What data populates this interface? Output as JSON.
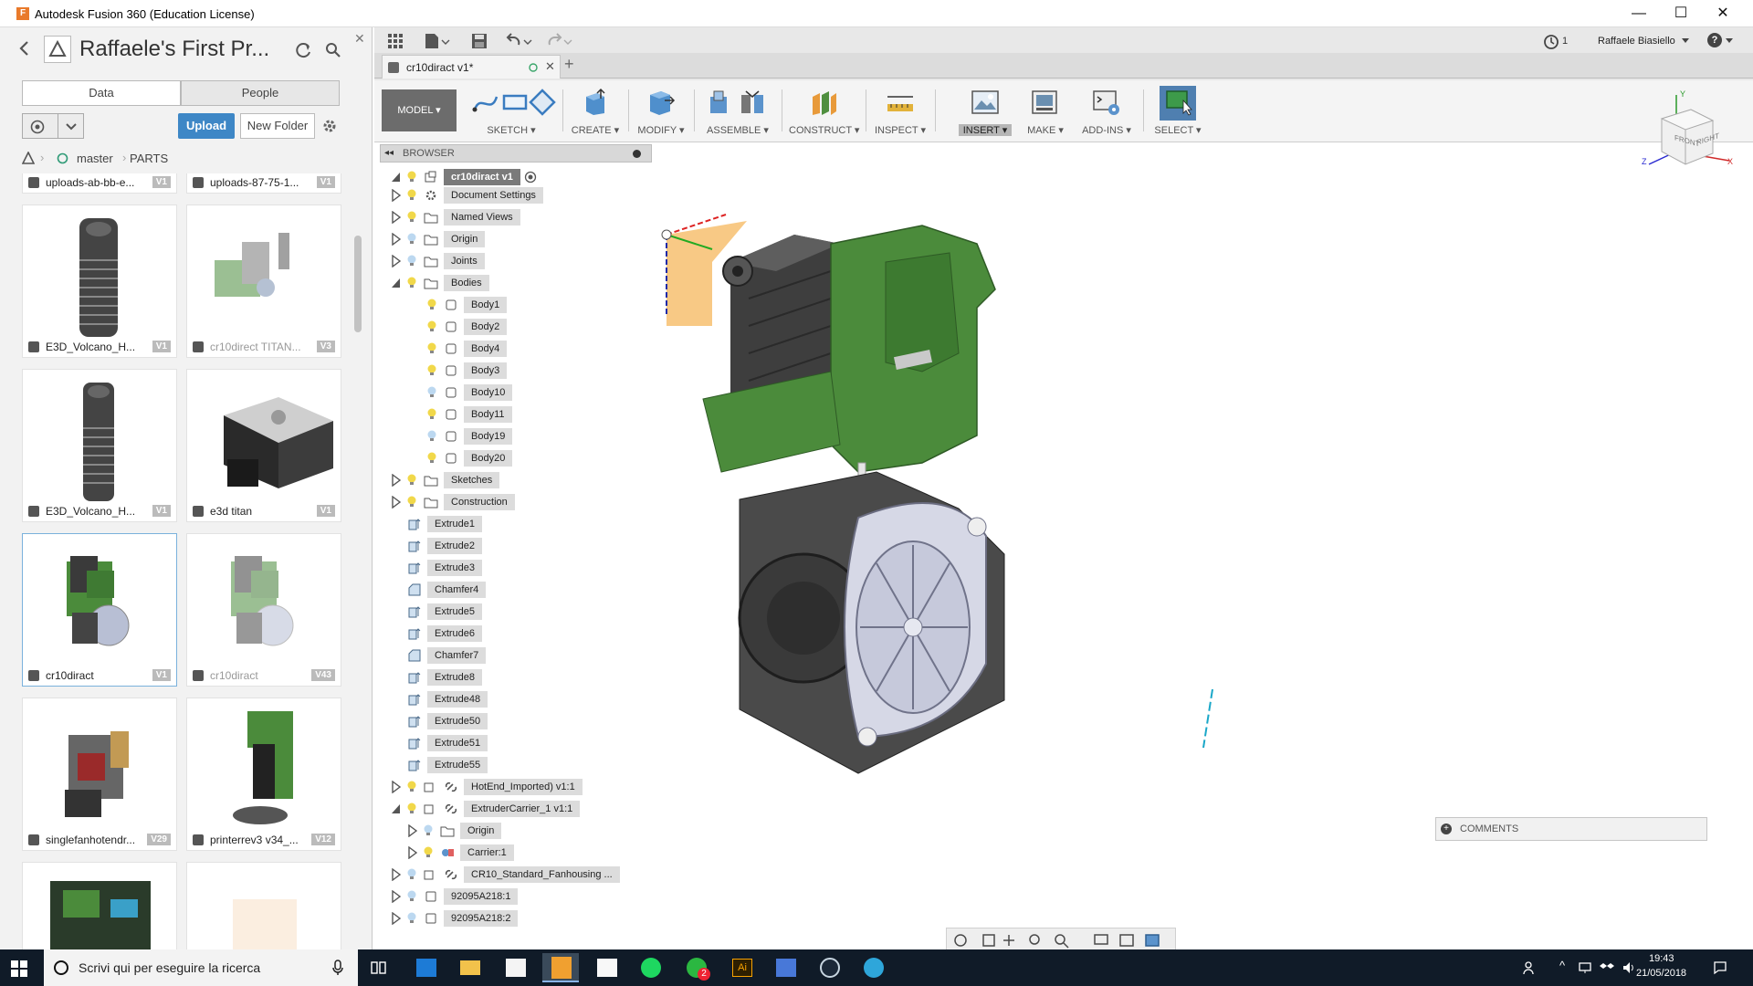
{
  "window": {
    "title": "Autodesk Fusion 360 (Education License)",
    "minimize": "—",
    "maximize": "☐",
    "close": "✕"
  },
  "data_panel": {
    "title": "Raffaele's First Pr...",
    "tabs": [
      "Data",
      "People"
    ],
    "upload_label": "Upload",
    "new_folder_label": "New Folder",
    "breadcrumb_branch": "master",
    "breadcrumb_folder": "PARTS",
    "files": [
      {
        "name": "uploads-ab-bb-e...",
        "version": "V1"
      },
      {
        "name": "uploads-87-75-1...",
        "version": "V1"
      },
      {
        "name": "E3D_Volcano_H...",
        "version": "V1"
      },
      {
        "name": "cr10direct TITAN...",
        "version": "V3"
      },
      {
        "name": "E3D_Volcano_H...",
        "version": "V1"
      },
      {
        "name": "e3d titan",
        "version": "V1"
      },
      {
        "name": "cr10diract",
        "version": "V1"
      },
      {
        "name": "cr10diract",
        "version": "V43"
      },
      {
        "name": "singlefanhotendr...",
        "version": "V29"
      },
      {
        "name": "printerrev3 v34_...",
        "version": "V12"
      }
    ]
  },
  "qat": {
    "history_count": "1",
    "user_name": "Raffaele Biasiello",
    "help": "?"
  },
  "doc_tab": {
    "name": "cr10diract v1*",
    "add": "+"
  },
  "ribbon": {
    "workspace": "MODEL",
    "groups": [
      "SKETCH",
      "CREATE",
      "MODIFY",
      "ASSEMBLE",
      "CONSTRUCT",
      "INSPECT",
      "INSERT",
      "MAKE",
      "ADD-INS",
      "SELECT"
    ],
    "active_group": "INSERT",
    "colors": {
      "accent": "#3e87c6",
      "body_green": "#4b8b3b",
      "face_gray": "#5b5b5b"
    }
  },
  "browser": {
    "header": "BROWSER",
    "root": "cr10diract v1",
    "nodes": [
      "Document Settings",
      "Named Views",
      "Origin",
      "Joints",
      "Bodies",
      "Body1",
      "Body2",
      "Body4",
      "Body3",
      "Body10",
      "Body11",
      "Body19",
      "Body20",
      "Sketches",
      "Construction",
      "Extrude1",
      "Extrude2",
      "Extrude3",
      "Chamfer4",
      "Extrude5",
      "Extrude6",
      "Chamfer7",
      "Extrude8",
      "Extrude48",
      "Extrude50",
      "Extrude51",
      "Extrude55",
      "HotEnd_Imported) v1:1",
      "ExtruderCarrier_1 v1:1",
      "Origin",
      "Carrier:1",
      "CR10_Standard_Fanhousing ...",
      "92095A218:1",
      "92095A218:2"
    ]
  },
  "viewcube": {
    "front": "FRONT",
    "right": "RIGHT",
    "y": "Y",
    "z": "Z",
    "x": "X"
  },
  "comments": {
    "label": "COMMENTS"
  },
  "taskbar": {
    "search_placeholder": "Scrivi qui per eseguire la ricerca",
    "time": "19:43",
    "date": "21/05/2018",
    "whatsapp_badge": "2"
  }
}
